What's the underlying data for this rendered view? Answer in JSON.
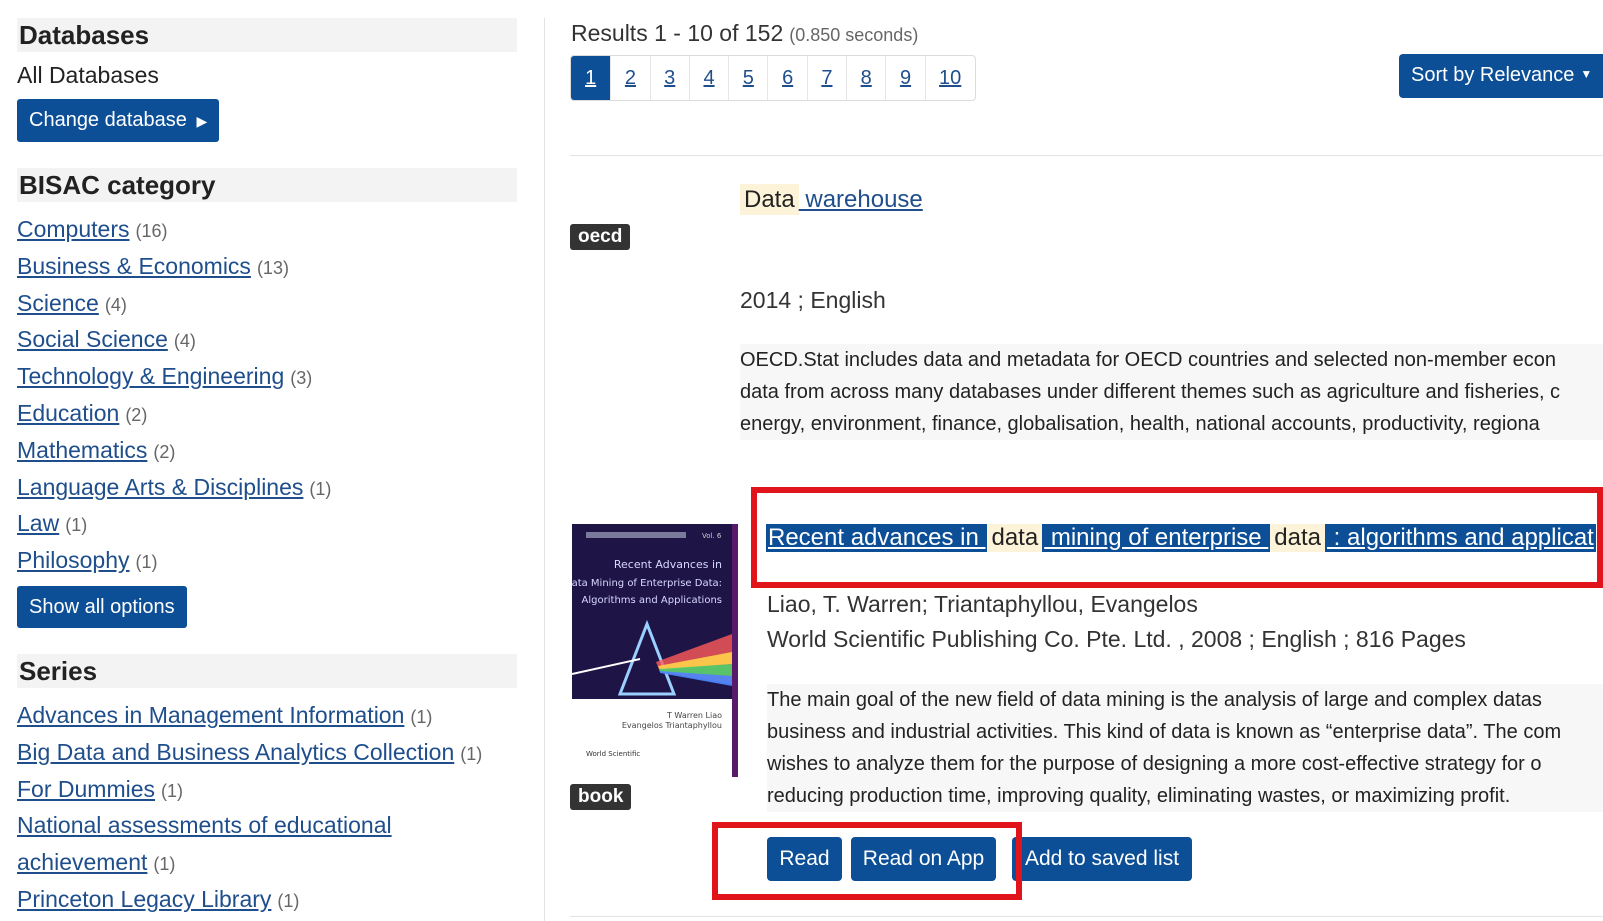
{
  "sidebar": {
    "databases_heading": "Databases",
    "all_databases": "All Databases",
    "change_database": "Change database",
    "bisac_heading": "BISAC category",
    "bisac_items": [
      {
        "label": "Computers",
        "count": "(16)"
      },
      {
        "label": "Business & Economics",
        "count": "(13)"
      },
      {
        "label": "Science",
        "count": "(4)"
      },
      {
        "label": "Social Science",
        "count": "(4)"
      },
      {
        "label": "Technology & Engineering",
        "count": "(3)"
      },
      {
        "label": "Education",
        "count": "(2)"
      },
      {
        "label": "Mathematics",
        "count": "(2)"
      },
      {
        "label": "Language Arts & Disciplines",
        "count": "(1)"
      },
      {
        "label": "Law",
        "count": "(1)"
      },
      {
        "label": "Philosophy",
        "count": "(1)"
      }
    ],
    "show_all": "Show all options",
    "series_heading": "Series",
    "series_items": [
      {
        "label": "Advances in Management Information",
        "count": "(1)"
      },
      {
        "label": "Big Data and Business Analytics Collection",
        "count": "(1)"
      },
      {
        "label": "For Dummies",
        "count": "(1)"
      },
      {
        "label": "National assessments of educational",
        "count": ""
      },
      {
        "label": "achievement",
        "count": "(1)"
      },
      {
        "label": "Princeton Legacy Library",
        "count": "(1)"
      }
    ]
  },
  "results": {
    "summary": "Results 1 - 10 of 152",
    "seconds": "(0.850 seconds)",
    "pages": [
      "1",
      "2",
      "3",
      "4",
      "5",
      "6",
      "7",
      "8",
      "9",
      "10"
    ],
    "sort_label": "Sort by Relevance"
  },
  "result1": {
    "badge": "oecd",
    "title_hl": "Data",
    "title_rest": " warehouse",
    "meta": "2014 ; English",
    "desc": [
      "OECD.Stat includes data and metadata for OECD countries and selected non-member econ",
      "data from across many databases under different themes such as agriculture and fisheries, c",
      "energy, environment, finance, globalisation, health, national accounts, productivity, regiona"
    ]
  },
  "result2": {
    "badge": "book",
    "title_parts": {
      "a": "Recent advances in ",
      "b": "data",
      "c": " mining of enterprise ",
      "d": "data",
      "e": " : algorithms and applicat"
    },
    "authors": "Liao, T. Warren; Triantaphyllou, Evangelos",
    "publisher": "World Scientific Publishing Co. Pte. Ltd. , 2008 ; English ; 816 Pages",
    "desc": [
      "The main goal of the new field of data mining is the analysis of large and complex datas",
      "business and industrial activities. This kind of data is known as “enterprise data”. The com",
      "wishes to analyze them for the purpose of designing a more cost-effective strategy for o",
      "reducing production time, improving quality, eliminating wastes, or maximizing profit."
    ],
    "cover": {
      "title_lines": [
        "Recent Advances in",
        "Data Mining of Enterprise Data:",
        "Algorithms and Applications"
      ],
      "authors": [
        "T Warren Liao",
        "Evangelos Triantaphyllou"
      ],
      "publisher": "World Scientific",
      "vol": "Vol. 6"
    },
    "read": "Read",
    "read_app": "Read on App",
    "save": "Add to saved list"
  },
  "colors": {
    "accent": "#0c4f96",
    "highlight_box": "#e0141a"
  }
}
